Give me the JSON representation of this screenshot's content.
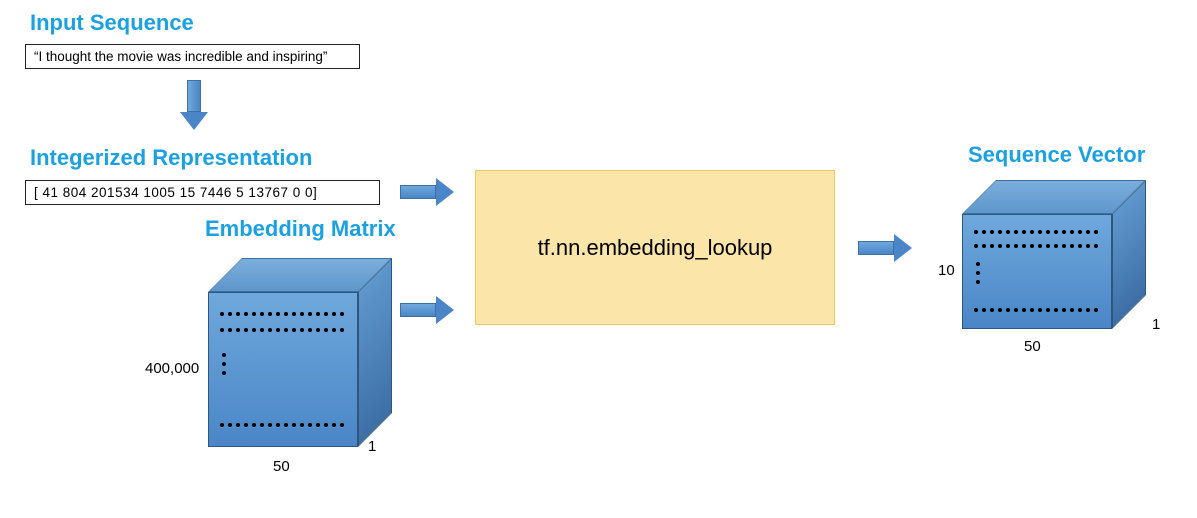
{
  "headings": {
    "input_sequence": "Input Sequence",
    "integerized": "Integerized Representation",
    "embedding_matrix": "Embedding Matrix",
    "sequence_vector": "Sequence Vector"
  },
  "input_text": "“I thought the movie was incredible and inspiring”",
  "integer_vector": "[ 41   804   201534   1005   15   7446   5   13767   0   0]",
  "lookup_function": "tf.nn.embedding_lookup",
  "embedding_matrix_dims": {
    "rows": "400,000",
    "cols": "50",
    "depth": "1"
  },
  "sequence_vector_dims": {
    "rows": "10",
    "cols": "50",
    "depth": "1"
  }
}
